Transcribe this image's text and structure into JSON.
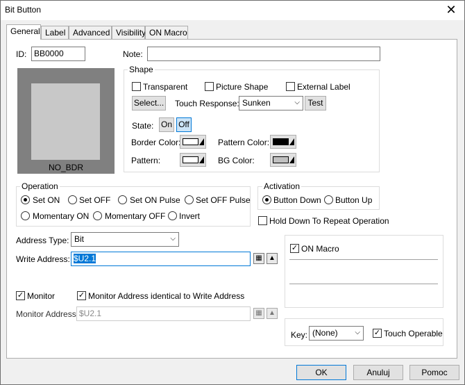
{
  "window": {
    "title": "Bit Button",
    "close_glyph": "✕"
  },
  "tabs": [
    "General",
    "Label",
    "Advanced",
    "Visibility",
    "ON Macro"
  ],
  "id_label": "ID:",
  "id_value": "BB0000",
  "note_label": "Note:",
  "note_value": "",
  "preview_caption": "NO_BDR",
  "shape": {
    "title": "Shape",
    "transparent": "Transparent",
    "picture_shape": "Picture Shape",
    "external_label": "External Label",
    "select_button": "Select...",
    "touch_response_label": "Touch Response:",
    "touch_response_value": "Sunken",
    "test_button": "Test",
    "state_label": "State:",
    "state_on": "On",
    "state_off": "Off",
    "border_color_label": "Border Color:",
    "pattern_color_label": "Pattern Color:",
    "pattern_label": "Pattern:",
    "bg_color_label": "BG Color:",
    "colors": {
      "border": "#ffffff",
      "pattern_color": "#000000",
      "pattern": "#ffffff",
      "bg": "#c0c0c0"
    }
  },
  "operation": {
    "title": "Operation",
    "set_on": "Set ON",
    "set_off": "Set OFF",
    "set_on_pulse": "Set ON Pulse",
    "set_off_pulse": "Set OFF Pulse",
    "momentary_on": "Momentary ON",
    "momentary_off": "Momentary OFF",
    "invert": "Invert"
  },
  "activation": {
    "title": "Activation",
    "button_down": "Button Down",
    "button_up": "Button Up"
  },
  "hold_down": "Hold Down To Repeat Operation",
  "address_type_label": "Address Type:",
  "address_type_value": "Bit",
  "write_address_label": "Write Address:",
  "write_address_value": "$U2.1",
  "on_macro": "ON Macro",
  "monitor": "Monitor",
  "monitor_identical": "Monitor Address identical to Write Address",
  "monitor_address_label": "Monitor Address:",
  "monitor_address_value": "$U2.1",
  "key_label": "Key:",
  "key_value": "(None)",
  "touch_operable": "Touch Operable",
  "footer": {
    "ok": "OK",
    "cancel": "Anuluj",
    "help": "Pomoc"
  }
}
